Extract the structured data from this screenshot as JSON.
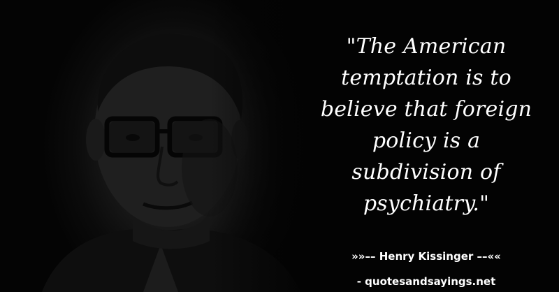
{
  "quote": {
    "lines": [
      "\"The American",
      "temptation is to",
      "believe that foreign",
      "policy is a",
      "subdivision of",
      "psychiatry.\""
    ]
  },
  "attribution": {
    "author": "»»–– Henry Kissinger ––««"
  },
  "source": {
    "text": "- quotesandsayings.net"
  },
  "colors": {
    "background": "#030303",
    "text": "#ffffff"
  }
}
